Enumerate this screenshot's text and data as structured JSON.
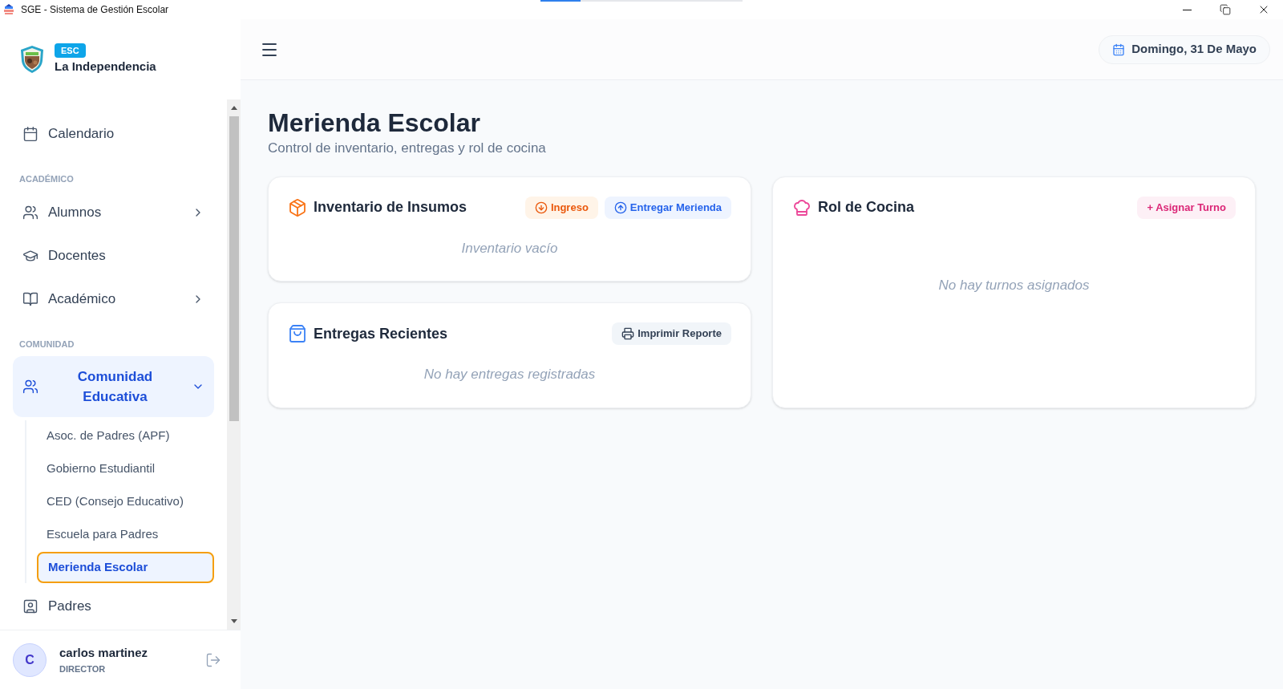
{
  "window": {
    "title": "SGE - Sistema de Gestión Escolar",
    "loading_bar": {
      "level": 0.2
    }
  },
  "sidebar": {
    "badge": "ESC",
    "school": "La Independencia",
    "sections": [
      {
        "items": [
          {
            "label": "Calendario",
            "selected": false
          }
        ]
      },
      {
        "heading": "ACADÉMICO",
        "items": [
          {
            "label": "Alumnos",
            "selected": false,
            "expanded": false
          },
          {
            "label": "Docentes",
            "selected": false
          },
          {
            "label": "Académico",
            "selected": false,
            "expanded": false
          }
        ]
      },
      {
        "heading": "COMUNIDAD",
        "items": [
          {
            "label": "Comunidad Educativa",
            "selected": true,
            "expanded": true,
            "children": [
              {
                "label": "Asoc. de Padres (APF)",
                "selected": false
              },
              {
                "label": "Gobierno Estudiantil",
                "selected": false
              },
              {
                "label": "CED (Consejo Educativo)",
                "selected": false
              },
              {
                "label": "Escuela para Padres",
                "selected": false
              },
              {
                "label": "Merienda Escolar",
                "selected": true
              }
            ]
          },
          {
            "label": "Padres",
            "selected": false
          }
        ]
      }
    ],
    "user": {
      "initial": "C",
      "name": "carlos martinez",
      "role": "DIRECTOR"
    }
  },
  "header": {
    "date": "Domingo, 31 De Mayo"
  },
  "page": {
    "title": "Merienda Escolar",
    "subtitle": "Control de inventario, entregas y rol de cocina",
    "cards": [
      {
        "title": "Inventario de Insumos",
        "actions": [
          "Ingreso",
          "Entregar Merienda"
        ],
        "empty": "Inventario vacío"
      },
      {
        "title": "Entregas Recientes",
        "actions": [
          "Imprimir Reporte"
        ],
        "empty": "No hay entregas registradas"
      },
      {
        "title": "Rol de Cocina",
        "actions": [
          "+ Asignar Turno"
        ],
        "empty": "No hay turnos asignados"
      }
    ]
  }
}
